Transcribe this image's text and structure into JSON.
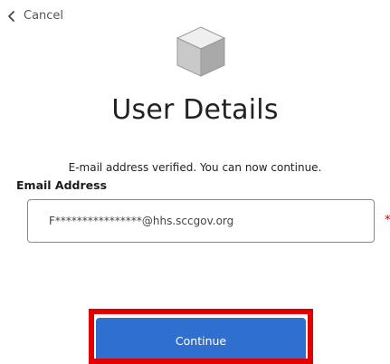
{
  "nav": {
    "cancel_label": "Cancel",
    "cancel_icon": "chevron-left-icon"
  },
  "logo": {
    "icon": "cube-icon",
    "colors": {
      "top": "#efefef",
      "left": "#c9c9c9",
      "right": "#a9a9a9",
      "stroke": "#9a9a9a"
    }
  },
  "page": {
    "title": "User Details",
    "verified_message": "E-mail address verified. You can now continue."
  },
  "form": {
    "email_label": "Email Address",
    "email_value": "F****************@hhs.sccgov.org",
    "required_marker": "*"
  },
  "actions": {
    "continue_label": "Continue",
    "button_color": "#2f6fcf",
    "highlight_color": "#e10000"
  }
}
